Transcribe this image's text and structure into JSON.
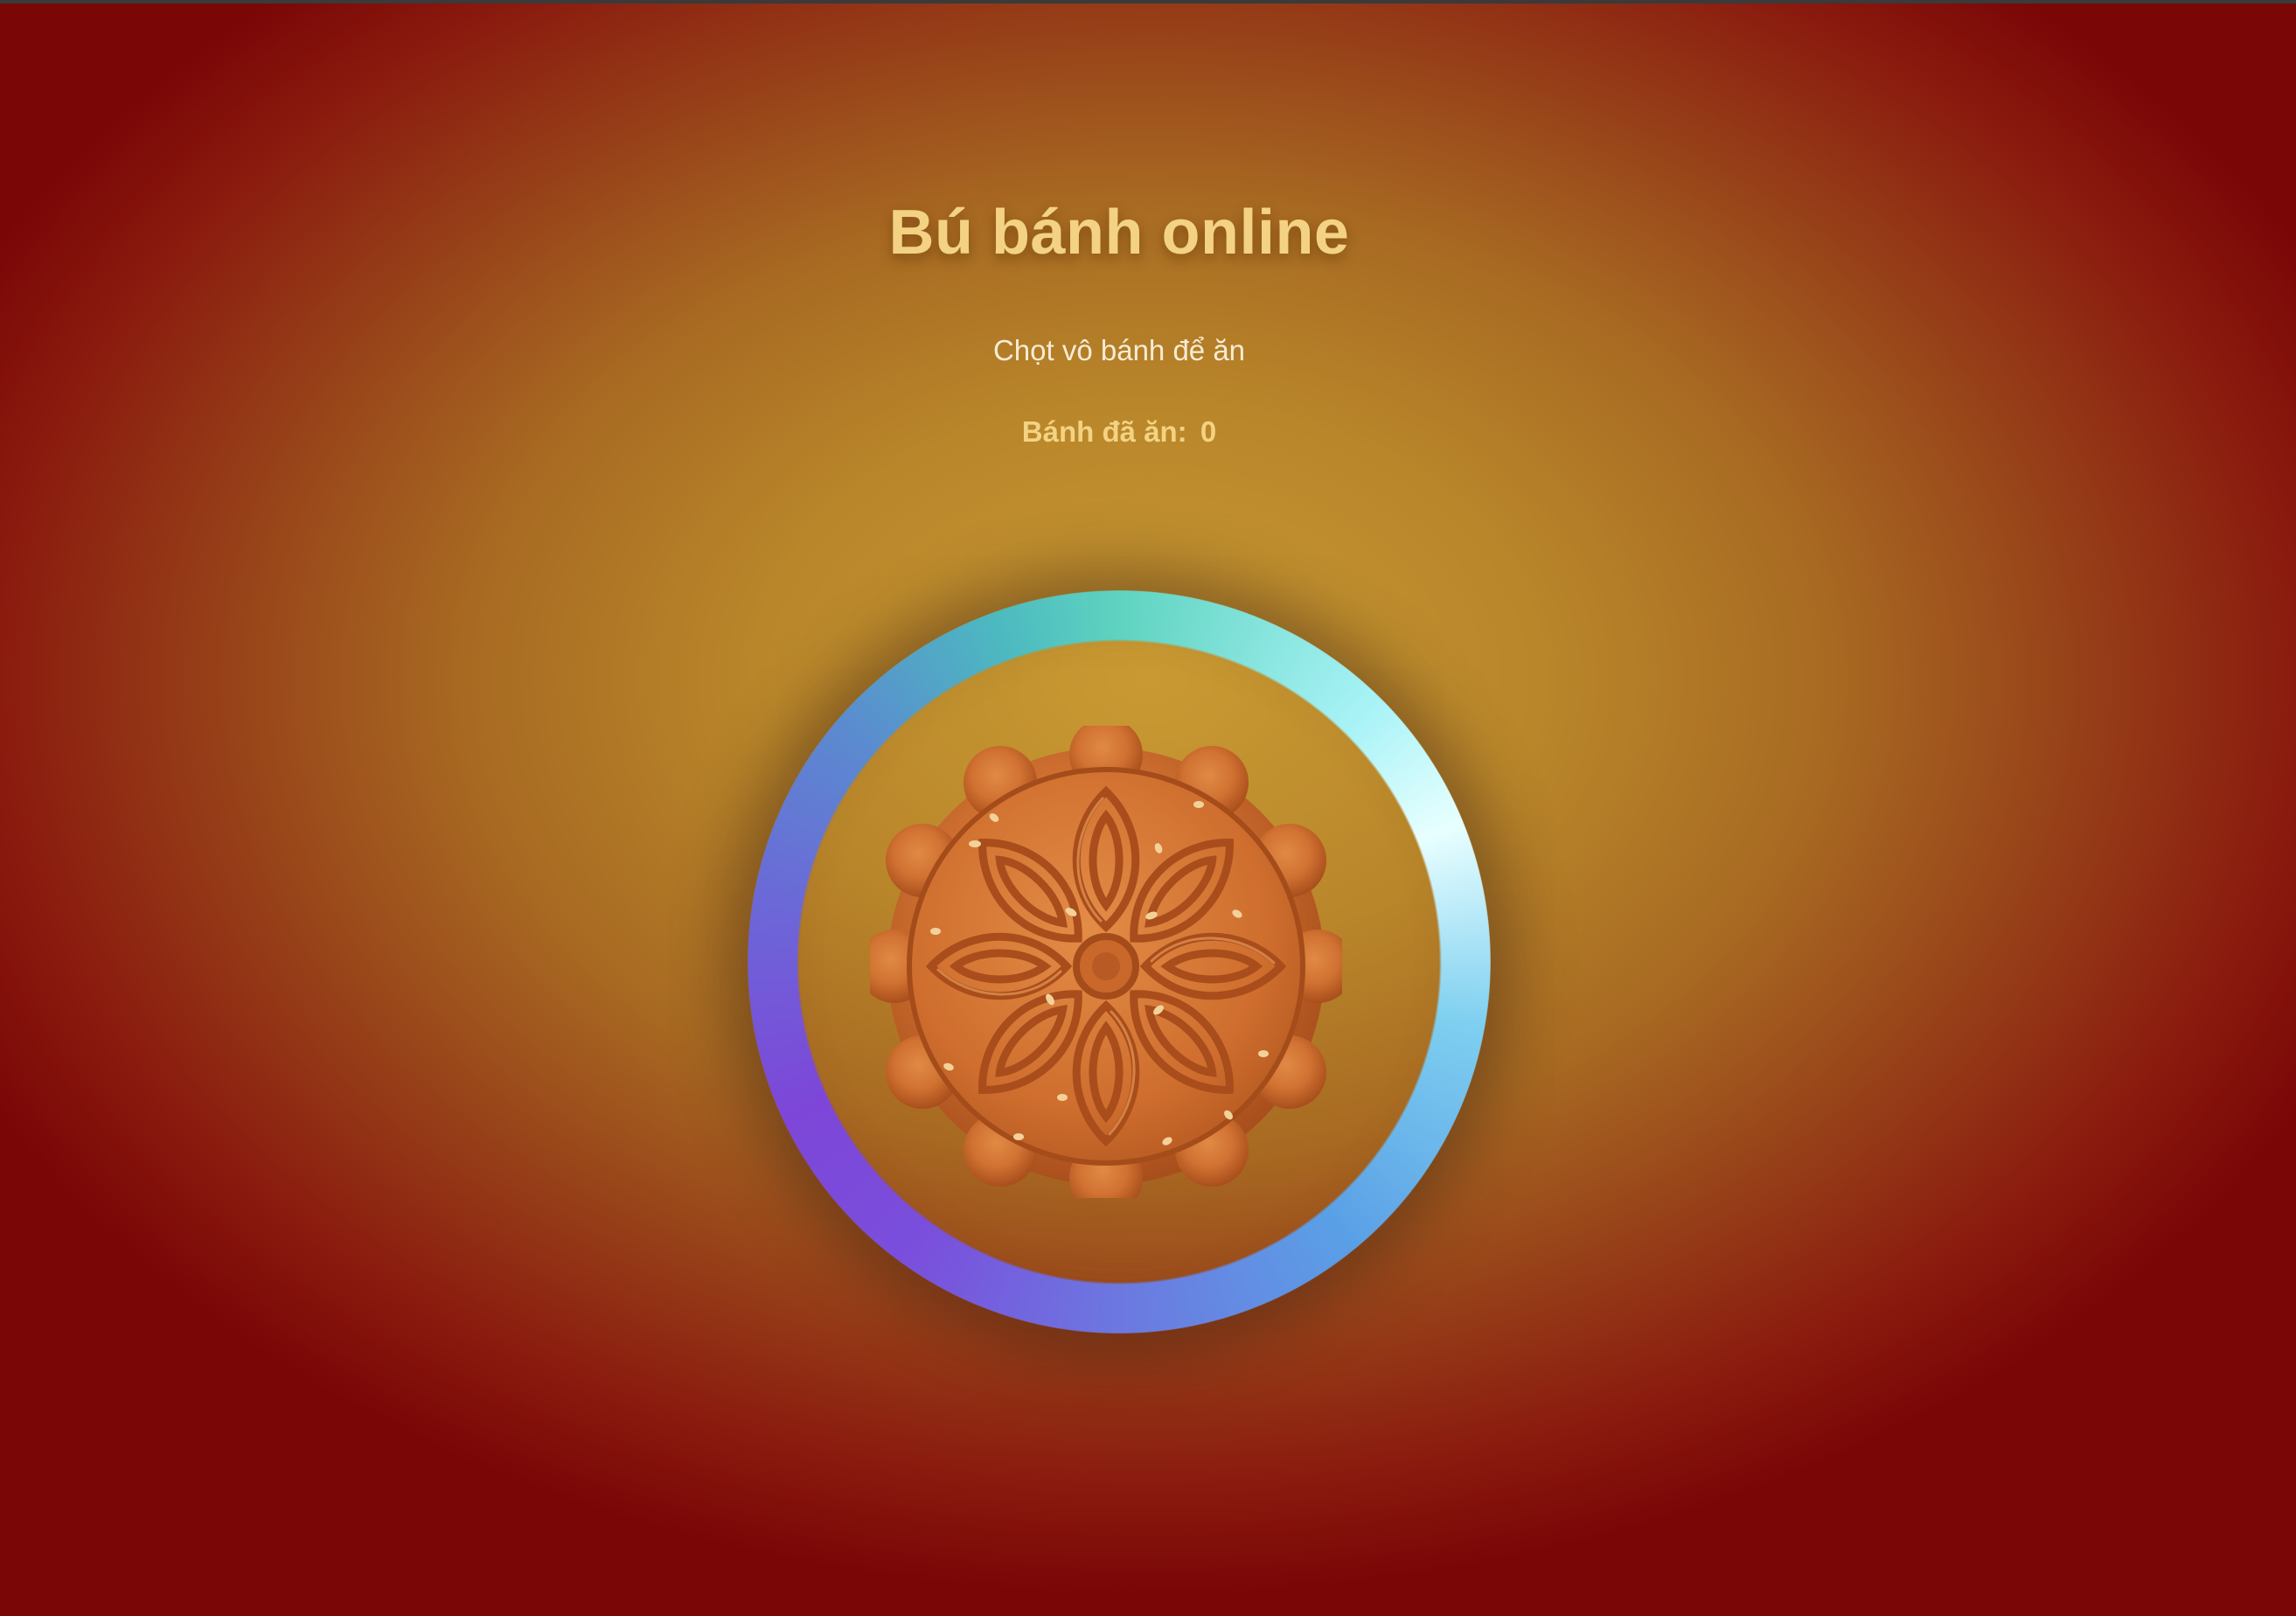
{
  "title": "Bú bánh online",
  "subtitle": "Chọt vô bánh để ăn",
  "counter": {
    "label": "Bánh đã ăn:",
    "value": "0"
  },
  "mooncake": {
    "icon": "mooncake-icon"
  },
  "colors": {
    "title": "#f3d283",
    "ring_teal": "#5fd3c0",
    "ring_purple": "#7a4fdc",
    "background_center": "#c99a33",
    "background_edge": "#7a0606"
  }
}
